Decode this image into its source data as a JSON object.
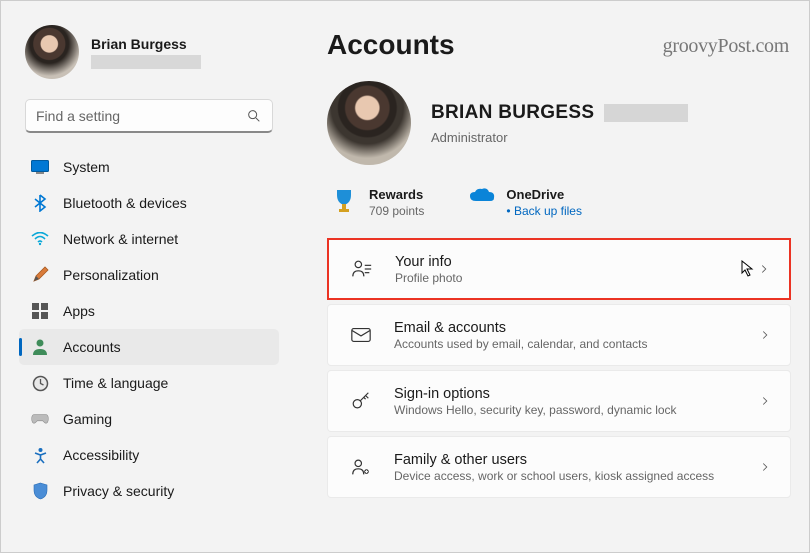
{
  "user": {
    "name": "Brian Burgess",
    "name_upper": "BRIAN BURGESS",
    "role": "Administrator"
  },
  "search": {
    "placeholder": "Find a setting"
  },
  "nav": {
    "items": [
      {
        "label": "System"
      },
      {
        "label": "Bluetooth & devices"
      },
      {
        "label": "Network & internet"
      },
      {
        "label": "Personalization"
      },
      {
        "label": "Apps"
      },
      {
        "label": "Accounts"
      },
      {
        "label": "Time & language"
      },
      {
        "label": "Gaming"
      },
      {
        "label": "Accessibility"
      },
      {
        "label": "Privacy & security"
      }
    ]
  },
  "page": {
    "title": "Accounts"
  },
  "tiles": {
    "rewards": {
      "title": "Rewards",
      "sub": "709 points"
    },
    "onedrive": {
      "title": "OneDrive",
      "sub": "Back up files"
    }
  },
  "rows": [
    {
      "title": "Your info",
      "sub": "Profile photo"
    },
    {
      "title": "Email & accounts",
      "sub": "Accounts used by email, calendar, and contacts"
    },
    {
      "title": "Sign-in options",
      "sub": "Windows Hello, security key, password, dynamic lock"
    },
    {
      "title": "Family & other users",
      "sub": "Device access, work or school users, kiosk assigned access"
    }
  ],
  "watermark": "groovyPost.com"
}
